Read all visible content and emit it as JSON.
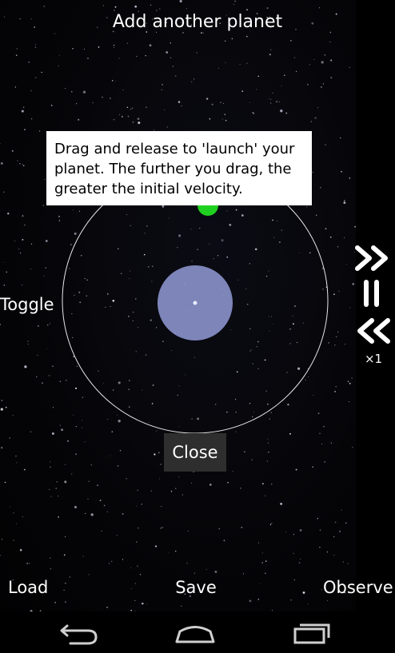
{
  "top": {
    "add_planet_label": "Add another planet"
  },
  "left": {
    "toggle_label": "Toggle"
  },
  "tooltip": {
    "text": "Drag and release to 'launch' your planet. The further you drag, the greater the initial velocity."
  },
  "dialog": {
    "close_label": "Close"
  },
  "speed": {
    "multiplier": "×1"
  },
  "bottom": {
    "load_label": "Load",
    "save_label": "Save",
    "observe_label": "Observe"
  },
  "colors": {
    "planet": "#8890c8",
    "orbiter": "#20d020",
    "tooltip_bg": "#ffffff",
    "close_bg": "#2e2e2e"
  }
}
